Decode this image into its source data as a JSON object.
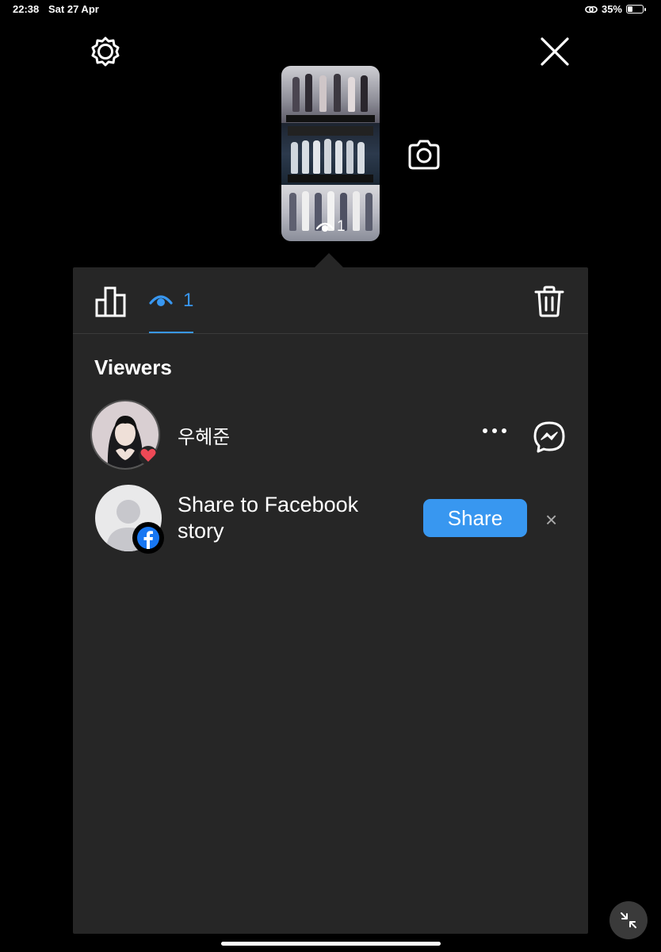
{
  "status_bar": {
    "time": "22:38",
    "date": "Sat 27 Apr",
    "battery": "35%"
  },
  "story_preview": {
    "view_count": "1"
  },
  "tabs": {
    "viewers_count": "1"
  },
  "viewers": {
    "title": "Viewers",
    "items": [
      {
        "name": "우혜준",
        "reaction": "heart"
      }
    ]
  },
  "share_prompt": {
    "text": "Share to Facebook story",
    "button_label": "Share",
    "dismiss_label": "×"
  },
  "colors": {
    "accent": "#3897f0",
    "panel": "#262626",
    "heart": "#ed4956",
    "facebook": "#1877f2"
  }
}
